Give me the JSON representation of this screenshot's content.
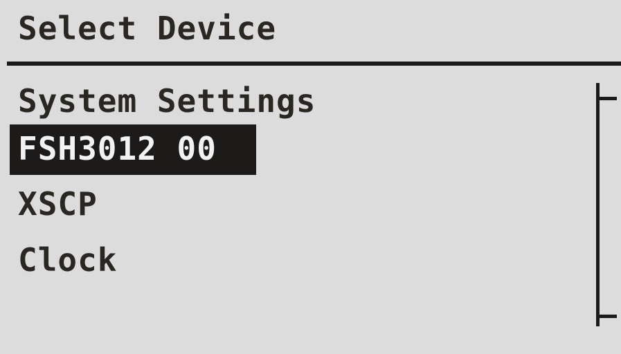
{
  "header": {
    "title": "Select Device"
  },
  "menu": {
    "items": [
      {
        "label": "System Settings",
        "selected": false
      },
      {
        "label": "FSH3012 00",
        "selected": true
      },
      {
        "label": "XSCP",
        "selected": false
      },
      {
        "label": "Clock",
        "selected": false
      }
    ]
  },
  "colors": {
    "screen_background": "#dcdcdc",
    "text": "#2a2722",
    "highlight_background": "#1c1b1a",
    "highlight_text": "#f2f2f2"
  }
}
